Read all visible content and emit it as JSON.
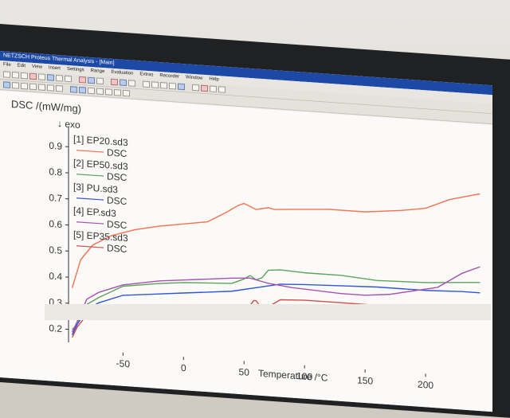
{
  "window": {
    "title": "NETZSCH Proteus Thermal Analysis - [Main]"
  },
  "menu": {
    "items": [
      "File",
      "Edit",
      "View",
      "Insert",
      "Settings",
      "Range",
      "Evaluation",
      "Extras",
      "Recorder",
      "Window",
      "Help"
    ]
  },
  "chart": {
    "ylabel": "DSC /(mW/mg)",
    "exo_label": "↓ exo",
    "xlabel": "Temperature /°C",
    "legend": [
      {
        "file": "[1] EP20.sd3",
        "label": "DSC",
        "color": "#f2734f"
      },
      {
        "file": "[2] EP50.sd3",
        "label": "DSC",
        "color": "#5aa35a"
      },
      {
        "file": "[3] PU.sd3",
        "label": "DSC",
        "color": "#2f55d6"
      },
      {
        "file": "[4] EP.sd3",
        "label": "DSC",
        "color": "#a552b0"
      },
      {
        "file": "[5] EP35.sd3",
        "label": "DSC",
        "color": "#d0504a"
      }
    ]
  },
  "chart_data": {
    "type": "line",
    "title": "",
    "xlabel": "Temperature /°C",
    "ylabel": "DSC /(mW/mg)",
    "xlim": [
      -95,
      250
    ],
    "ylim": [
      0.15,
      0.95
    ],
    "x_ticks": [
      -50,
      0,
      50,
      100,
      150,
      200
    ],
    "y_ticks": [
      0.2,
      0.3,
      0.4,
      0.5,
      0.6,
      0.7,
      0.8,
      0.9
    ],
    "legend_position": "top-left",
    "series": [
      {
        "name": "[1] EP20.sd3",
        "color": "#f2734f",
        "x": [
          -92,
          -85,
          -75,
          -60,
          -40,
          -20,
          0,
          20,
          35,
          45,
          50,
          55,
          60,
          65,
          70,
          75,
          90,
          120,
          150,
          180,
          200,
          220,
          245
        ],
        "y": [
          0.36,
          0.47,
          0.53,
          0.57,
          0.6,
          0.62,
          0.635,
          0.65,
          0.69,
          0.72,
          0.73,
          0.72,
          0.71,
          0.715,
          0.72,
          0.715,
          0.72,
          0.73,
          0.73,
          0.745,
          0.76,
          0.8,
          0.83
        ]
      },
      {
        "name": "[2] EP50.sd3",
        "color": "#5aa35a",
        "x": [
          -92,
          -88,
          -80,
          -70,
          -50,
          -20,
          0,
          20,
          40,
          50,
          55,
          60,
          65,
          70,
          80,
          100,
          130,
          160,
          200,
          230,
          245
        ],
        "y": [
          0.2,
          0.22,
          0.3,
          0.33,
          0.38,
          0.4,
          0.41,
          0.415,
          0.42,
          0.44,
          0.455,
          0.44,
          0.45,
          0.48,
          0.485,
          0.48,
          0.48,
          0.47,
          0.475,
          0.485,
          0.49
        ]
      },
      {
        "name": "[3] PU.sd3",
        "color": "#2f55d6",
        "x": [
          -92,
          -88,
          -80,
          -70,
          -50,
          -20,
          0,
          20,
          40,
          60,
          80,
          100,
          130,
          160,
          200,
          230,
          245
        ],
        "y": [
          0.18,
          0.22,
          0.28,
          0.31,
          0.345,
          0.36,
          0.37,
          0.38,
          0.39,
          0.41,
          0.43,
          0.435,
          0.44,
          0.445,
          0.445,
          0.45,
          0.45
        ]
      },
      {
        "name": "[4] EP.sd3",
        "color": "#a552b0",
        "x": [
          -92,
          -88,
          -80,
          -70,
          -50,
          -20,
          0,
          20,
          40,
          55,
          70,
          90,
          110,
          130,
          150,
          170,
          190,
          210,
          230,
          245
        ],
        "y": [
          0.19,
          0.23,
          0.32,
          0.35,
          0.385,
          0.41,
          0.42,
          0.43,
          0.44,
          0.445,
          0.43,
          0.42,
          0.415,
          0.41,
          0.41,
          0.42,
          0.44,
          0.46,
          0.52,
          0.55
        ]
      },
      {
        "name": "[5] EP35.sd3",
        "color": "#d0504a",
        "x": [
          -92,
          -88,
          -80,
          -70,
          -50,
          -20,
          0,
          20,
          40,
          55,
          58,
          60,
          63,
          70,
          80,
          100,
          130,
          160,
          200,
          245
        ],
        "y": [
          0.17,
          0.21,
          0.26,
          0.28,
          0.3,
          0.315,
          0.32,
          0.325,
          0.335,
          0.34,
          0.36,
          0.36,
          0.34,
          0.34,
          0.37,
          0.375,
          0.375,
          0.375,
          0.375,
          0.375
        ]
      }
    ]
  }
}
